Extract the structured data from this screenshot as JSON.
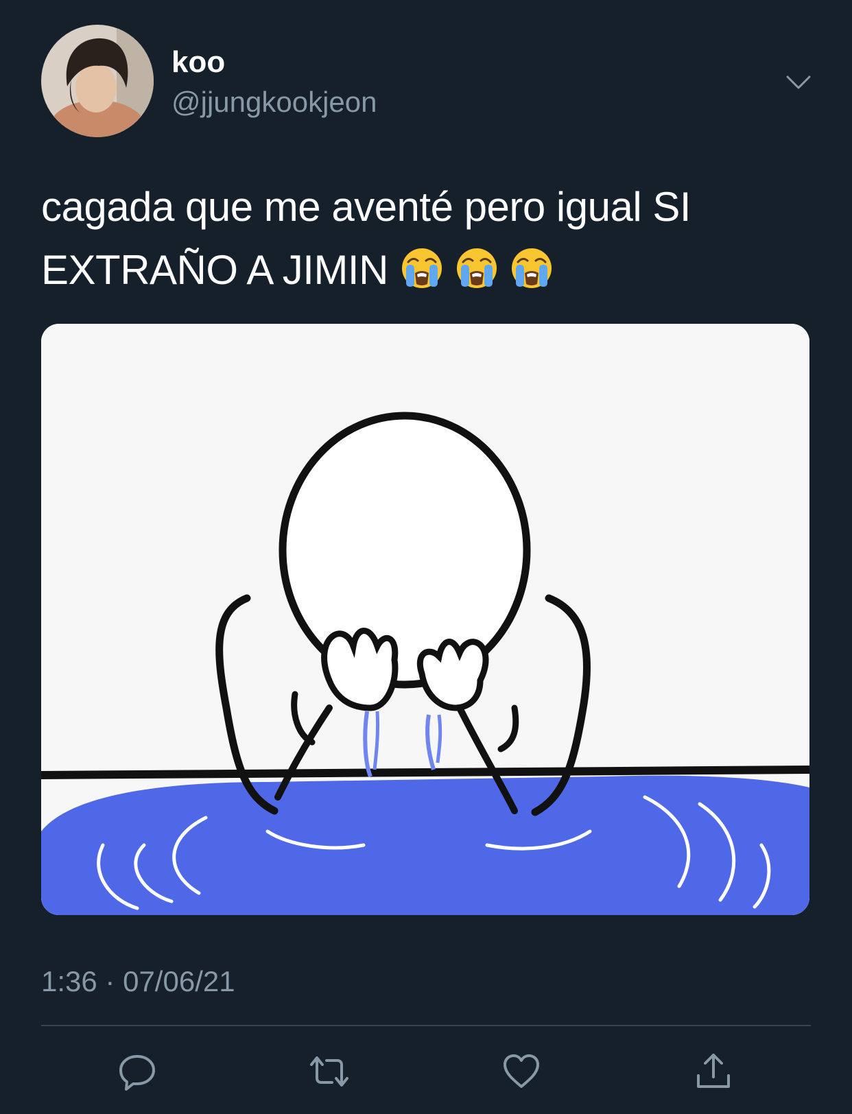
{
  "tweet": {
    "display_name": "koo",
    "handle": "@jjungkookjeon",
    "text_line1": "cagada que me aventé pero igual SI",
    "text_line2": "EXTRAÑO A JIMIN",
    "emojis": [
      "loudly-crying-face",
      "loudly-crying-face",
      "loudly-crying-face"
    ],
    "time": "1:36",
    "separator": "·",
    "date": "07/06/21"
  },
  "media": {
    "description_icon": "crying-stick-figure-image"
  },
  "actions": {
    "icons": [
      "reply-icon",
      "retweet-icon",
      "like-icon",
      "share-icon"
    ]
  },
  "colors": {
    "background": "#15202b",
    "secondary_text": "#8899a6",
    "divider": "#38444d",
    "puddle": "#4f68e8"
  }
}
